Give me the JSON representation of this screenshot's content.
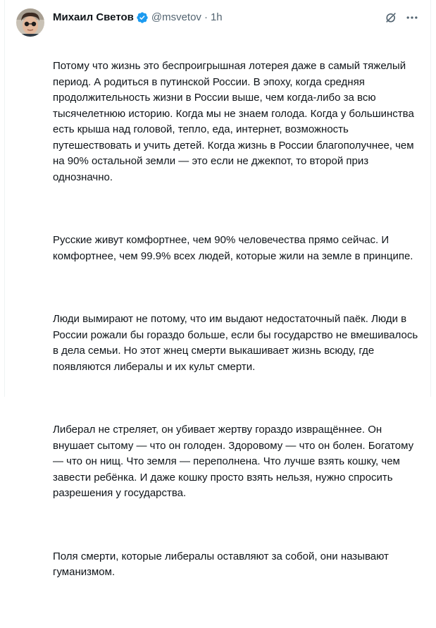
{
  "author": {
    "display_name": "Михаил Светов",
    "handle": "@msvetov",
    "separator": "·",
    "time": "1h",
    "verified_color": "#1d9bf0"
  },
  "icons": {
    "verified": "verified-badge-icon",
    "grok": "grok-icon",
    "more": "more-dots-icon"
  },
  "tweet": {
    "paragraphs": [
      "Потому что жизнь это беспроигрышная лотерея даже в самый тяжелый период. А родиться в путинской России. В эпоху, когда средняя продолжительность жизни в России выше, чем когда-либо за всю тысячелетнюю историю. Когда мы не знаем голода. Когда у большинства есть крыша над головой, тепло, еда, интернет, возможность путешествовать и учить детей. Когда жизнь в России благополучнее, чем на 90% остальной земли — это если не джекпот, то второй приз однозначно.",
      "Русские живут комфортнее, чем 90% человечества прямо сейчас. И комфортнее, чем 99.9% всех людей, которые жили на земле в принципе.",
      "Люди вымирают не потому, что им выдают недостаточный паёк. Люди в России рожали бы гораздо больше, если бы государство не вмешивалось в дела семьи. Но этот жнец смерти выкашивает жизнь всюду, где появляются либералы и их культ смерти.",
      "Либерал не стреляет, он убивает жертву гораздо извращённее. Он внушает сытому — что он голоден. Здоровому — что он болен. Богатому — что он нищ. Что земля — переполнена. Что лучше взять кошку, чем завести ребёнка. И даже кошку просто взять нельзя, нужно спросить разрешения у государства.",
      "Поля смерти, которые либералы оставляют за собой, они называют гуманизмом."
    ]
  }
}
